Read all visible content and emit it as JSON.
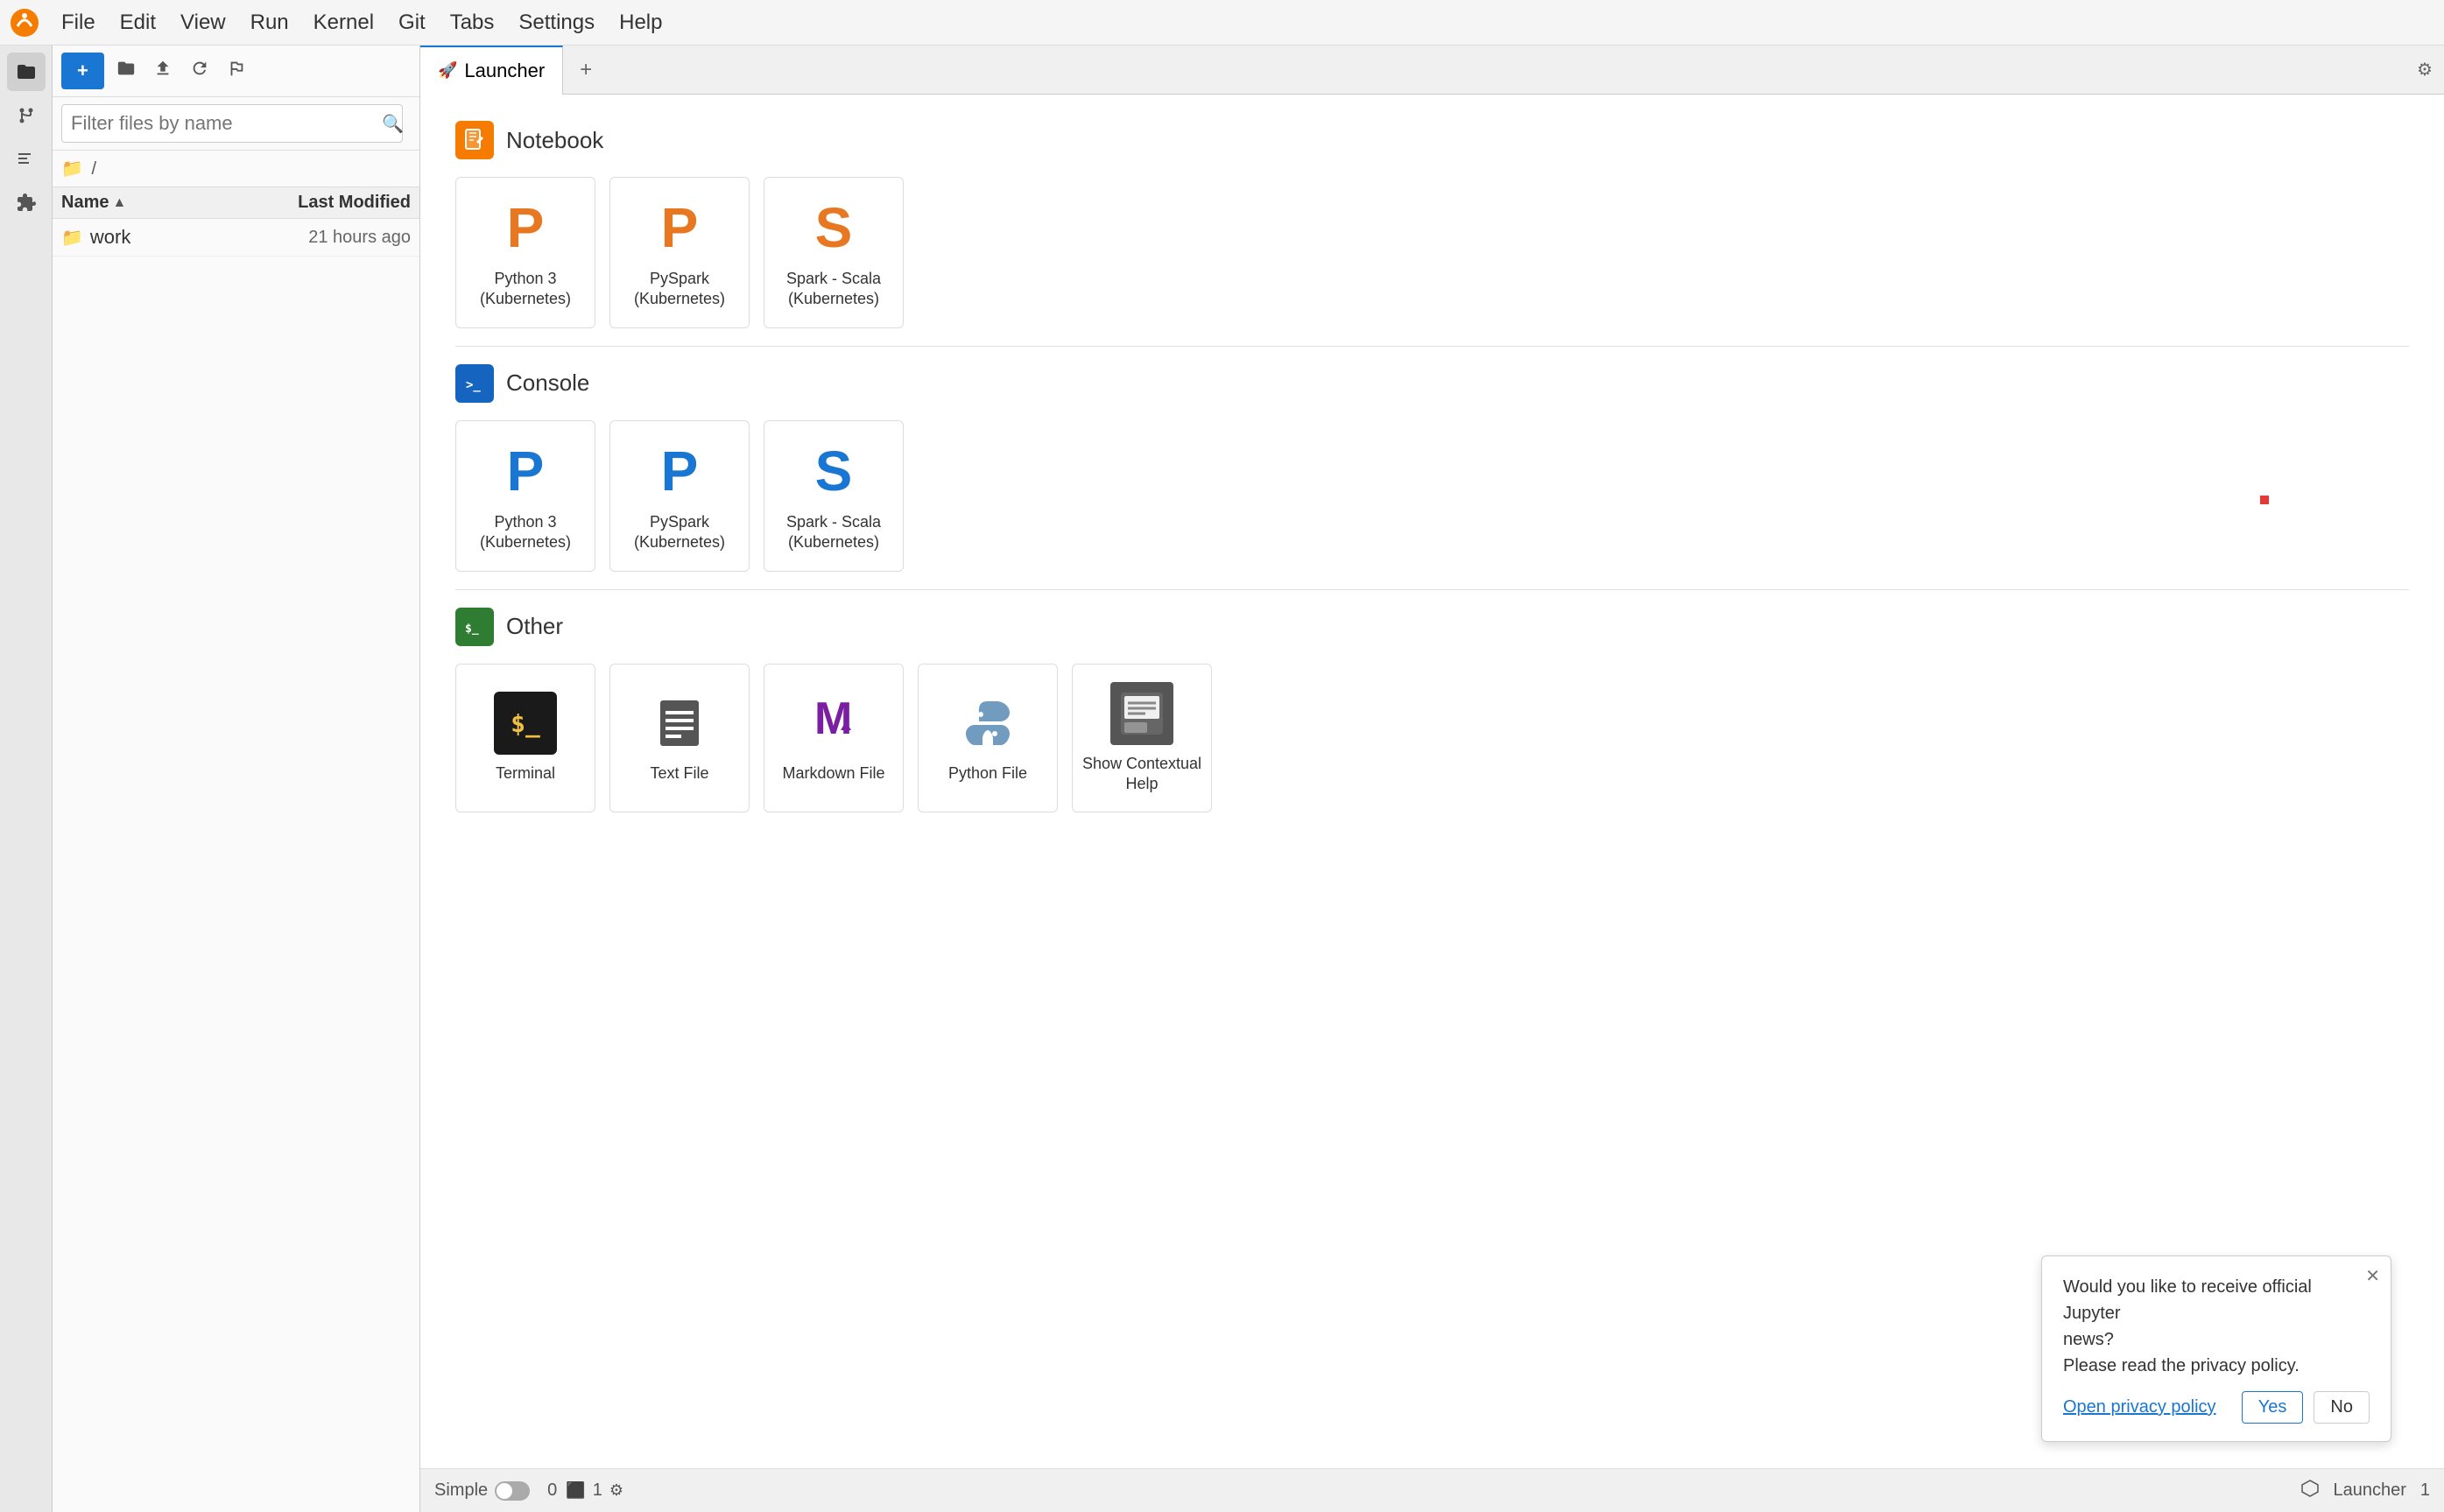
{
  "app": {
    "title": "JupyterLab"
  },
  "menubar": {
    "items": [
      "File",
      "Edit",
      "View",
      "Run",
      "Kernel",
      "Git",
      "Tabs",
      "Settings",
      "Help"
    ]
  },
  "activity_bar": {
    "icons": [
      {
        "name": "folder-icon",
        "symbol": "📁",
        "active": true
      },
      {
        "name": "git-icon",
        "symbol": "⌥",
        "active": false
      },
      {
        "name": "list-icon",
        "symbol": "☰",
        "active": false
      },
      {
        "name": "puzzle-icon",
        "symbol": "🧩",
        "active": false
      }
    ]
  },
  "file_panel": {
    "new_button_label": "+",
    "toolbar_icons": [
      "folder-new",
      "upload",
      "refresh",
      "git-branch"
    ],
    "search_placeholder": "Filter files by name",
    "breadcrumb": "/ /",
    "columns": {
      "name": "Name",
      "modified": "Last Modified"
    },
    "files": [
      {
        "icon": "📁",
        "name": "work",
        "modified": "21 hours ago"
      }
    ]
  },
  "tabs": {
    "active_tab": "Launcher",
    "add_button_label": "+"
  },
  "launcher": {
    "sections": [
      {
        "id": "notebook",
        "icon_label": "🔖",
        "title": "Notebook",
        "cards": [
          {
            "id": "py3-notebook",
            "icon": "P",
            "icon_class": "py3-nb",
            "label": "Python 3\n(Kubernetes)"
          },
          {
            "id": "pyspark-notebook",
            "icon": "P",
            "icon_class": "pyspark-nb",
            "label": "PySpark\n(Kubernetes)"
          },
          {
            "id": "spark-scala-notebook",
            "icon": "S",
            "icon_class": "spark-scala-nb",
            "label": "Spark - Scala\n(Kubernetes)"
          }
        ]
      },
      {
        "id": "console",
        "icon_label": ">_",
        "title": "Console",
        "cards": [
          {
            "id": "py3-console",
            "icon": "P",
            "icon_class": "py3-con",
            "label": "Python 3\n(Kubernetes)"
          },
          {
            "id": "pyspark-console",
            "icon": "P",
            "icon_class": "pyspark-con",
            "label": "PySpark\n(Kubernetes)"
          },
          {
            "id": "spark-scala-console",
            "icon": "S",
            "icon_class": "spark-scala-con",
            "label": "Spark - Scala\n(Kubernetes)"
          }
        ]
      },
      {
        "id": "other",
        "icon_label": "$_",
        "title": "Other",
        "cards": [
          {
            "id": "terminal",
            "type": "terminal",
            "label": "Terminal"
          },
          {
            "id": "text-file",
            "type": "textfile",
            "label": "Text File"
          },
          {
            "id": "markdown-file",
            "type": "markdown",
            "label": "Markdown File"
          },
          {
            "id": "python-file",
            "type": "pyfile",
            "label": "Python File"
          },
          {
            "id": "contextual-help",
            "type": "help",
            "label": "Show Contextual Help"
          }
        ]
      }
    ]
  },
  "notification": {
    "message_line1": "Would you like to receive official Jupyter",
    "message_line2": "news?",
    "message_line3": "Please read the privacy policy.",
    "link_label": "Open privacy policy",
    "yes_label": "Yes",
    "no_label": "No"
  },
  "status_bar": {
    "mode": "Simple",
    "kernel_count": "0",
    "kernel_icon": "⬛",
    "terminal_count": "1",
    "git_label": "",
    "right_label": "Launcher",
    "right_count": "1"
  }
}
